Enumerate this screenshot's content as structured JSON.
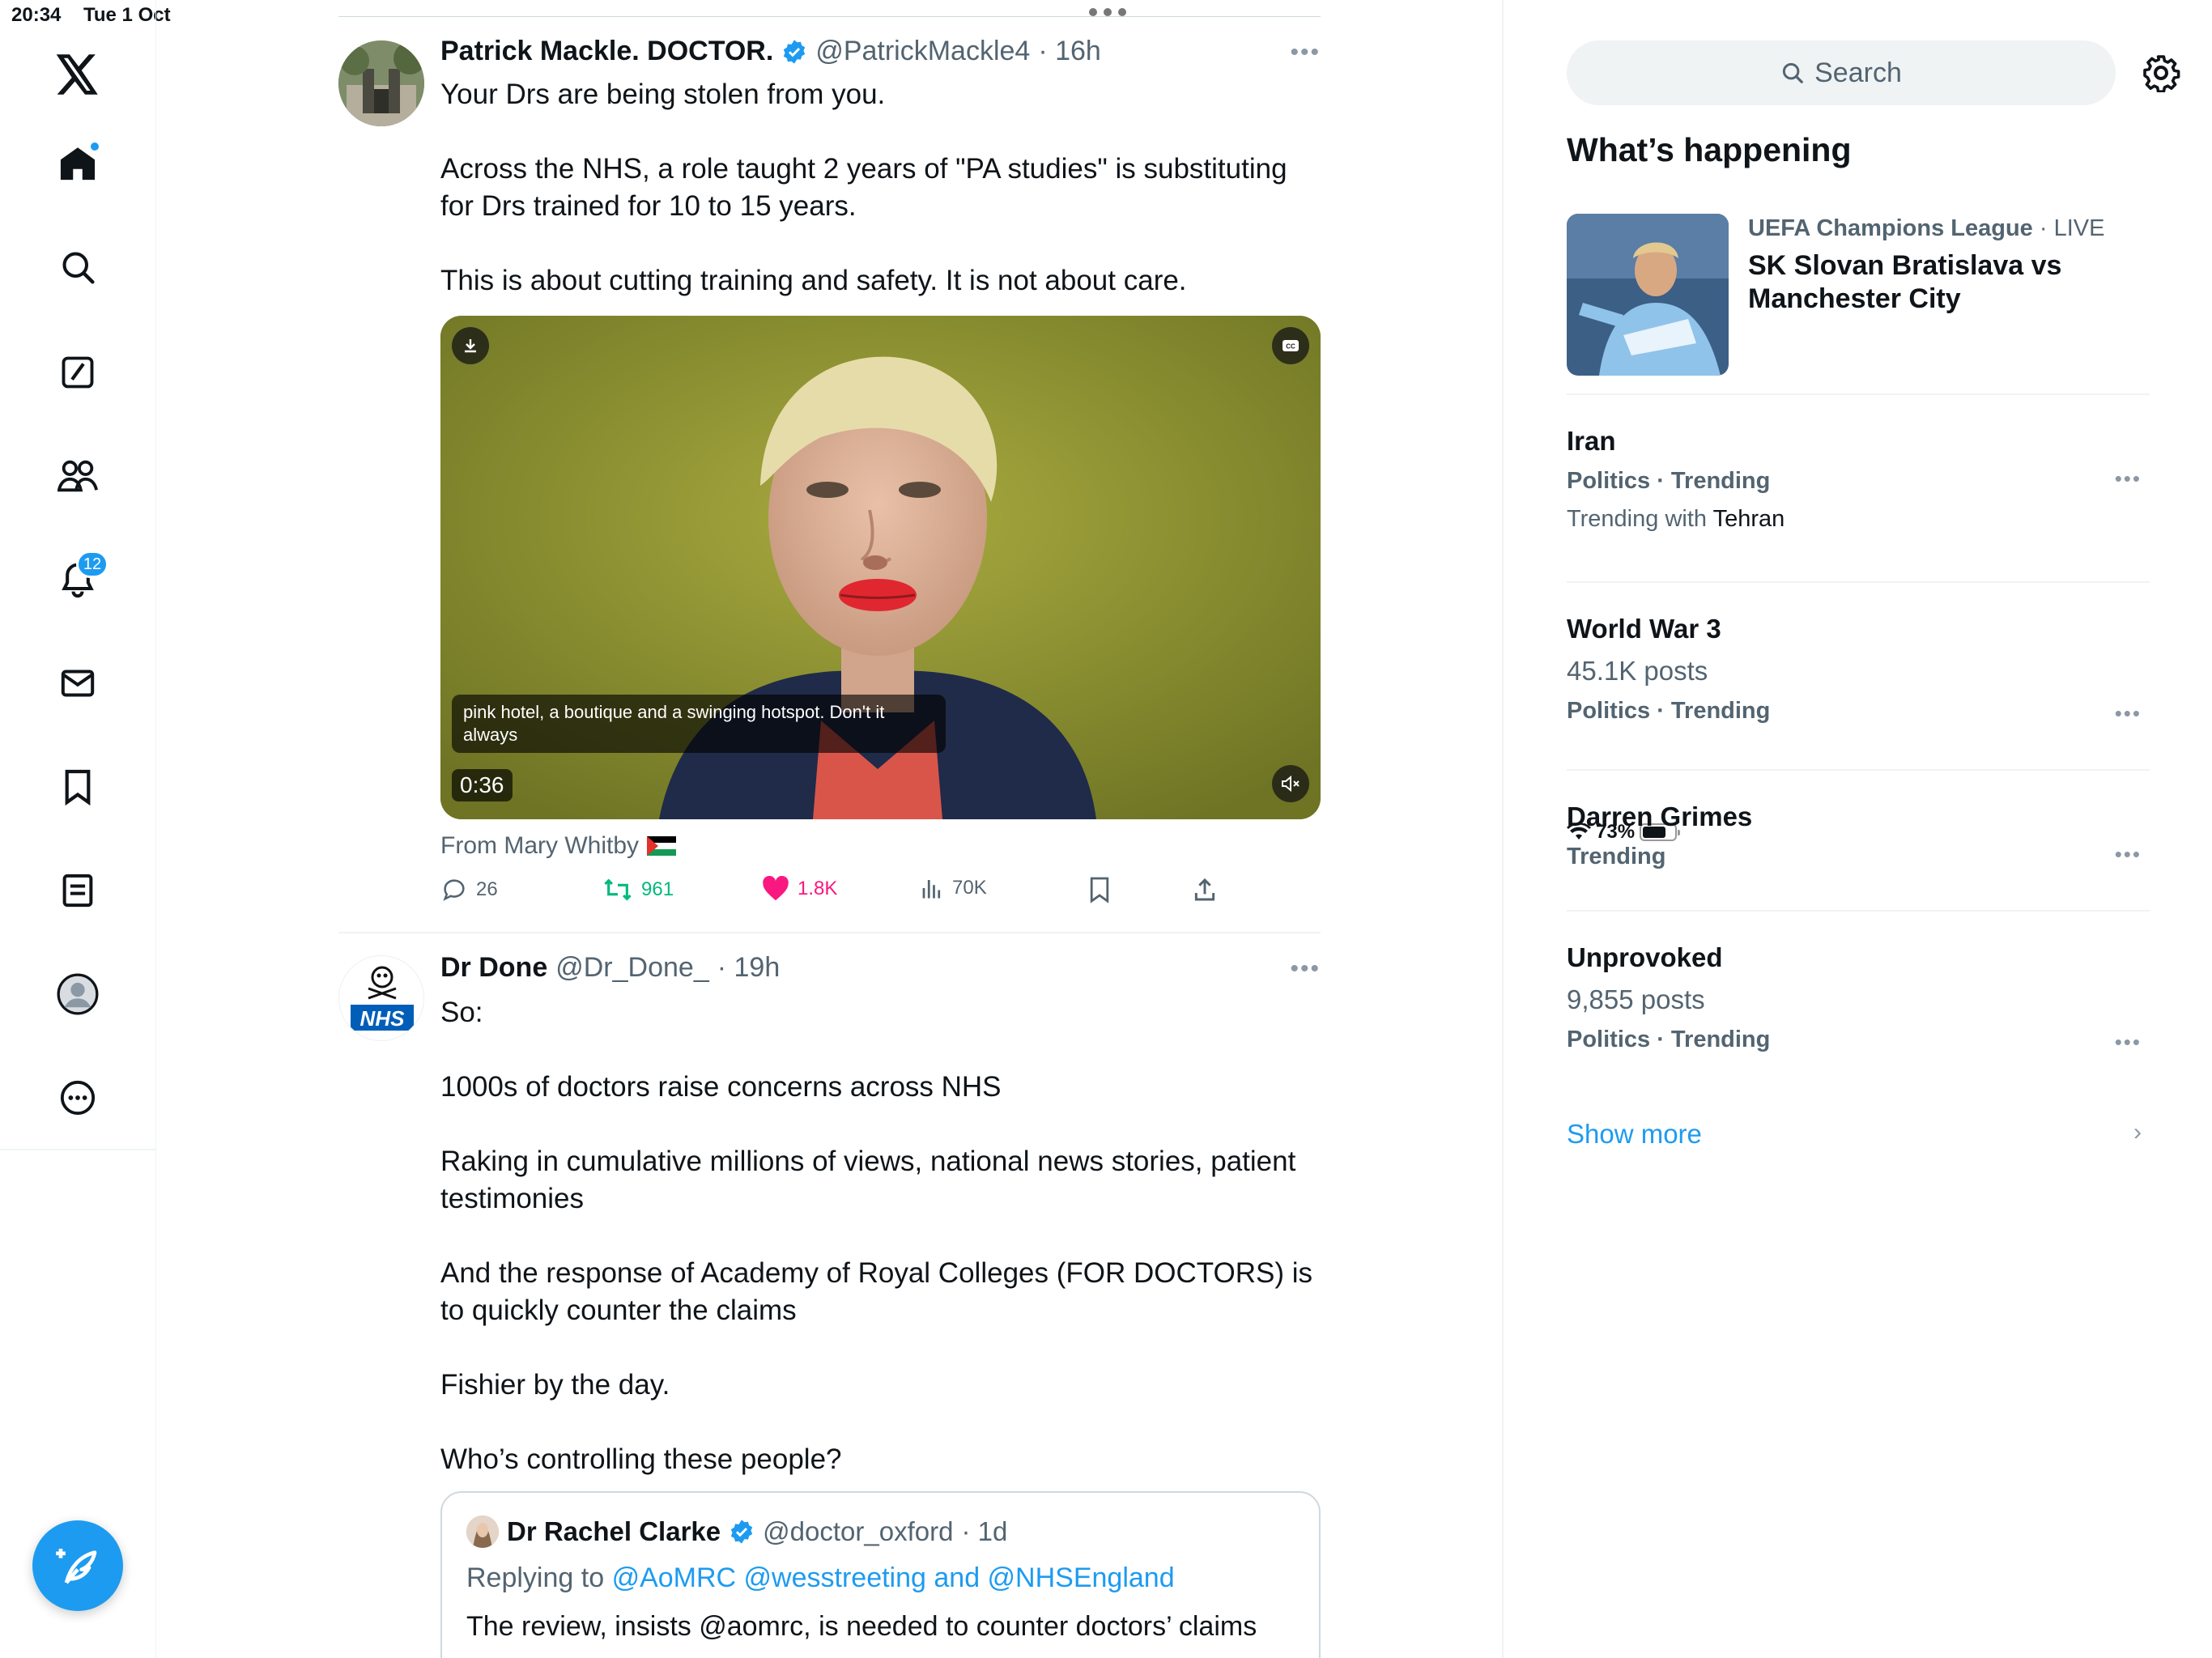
{
  "status_bar": {
    "time": "20:34",
    "date": "Tue 1 Oct",
    "battery": "73%"
  },
  "nav": {
    "notifications_badge": "12"
  },
  "tweets": [
    {
      "name": "Patrick Mackle. DOCTOR.",
      "handle": "@PatrickMackle4",
      "time": "· 16h",
      "verified": true,
      "paragraphs": [
        "Your Drs are being stolen from you.",
        "Across the NHS, a role taught 2 years of  \"PA studies\"  is substituting for Drs trained for 10 to 15 years.",
        "This is about cutting training and safety.  It is not about care."
      ],
      "video": {
        "caption": "pink hotel, a boutique and a swinging hotspot. Don't it always",
        "duration": "0:36"
      },
      "from": "From Mary Whitby",
      "replies": "26",
      "reposts": "961",
      "likes": "1.8K",
      "views": "70K"
    },
    {
      "name": "Dr Done",
      "handle": "@Dr_Done_",
      "time": "· 19h",
      "verified": false,
      "paragraphs": [
        "So:",
        "1000s of doctors raise concerns across NHS",
        "Raking in cumulative millions of views, national news stories, patient testimonies",
        "And the response of Academy of Royal Colleges (FOR DOCTORS) is to quickly counter the claims",
        "Fishier by the day.",
        "Who’s controlling these people?"
      ],
      "quote": {
        "name": "Dr Rachel Clarke",
        "handle": "@doctor_oxford",
        "time": "· 1d",
        "replying_prefix": "Replying to",
        "replying_to": "@AoMRC @wesstreeting and @NHSEngland",
        "text": "The review, insists @aomrc, is needed to counter doctors’ claims"
      }
    }
  ],
  "sidebar": {
    "search_placeholder": "Search",
    "heading": "What’s happening",
    "event": {
      "league": "UEFA Champions League",
      "status": "· LIVE",
      "title": "SK Slovan Bratislava vs Manchester City"
    },
    "trends": [
      {
        "title": "Iran",
        "category": "Politics · Trending",
        "with_prefix": "Trending with",
        "with": "Tehran"
      },
      {
        "title": "World War 3",
        "posts": "45.1K posts",
        "category": "Politics · Trending"
      },
      {
        "title": "Darren Grimes",
        "category": "Trending"
      },
      {
        "title": "Unprovoked",
        "posts": "9,855 posts",
        "category": "Politics · Trending"
      }
    ],
    "show_more": "Show more"
  },
  "colors": {
    "accent": "#1d9bf0",
    "like": "#f91880",
    "repost": "#00ba7c",
    "text": "#0f1419",
    "muted": "#536471"
  }
}
